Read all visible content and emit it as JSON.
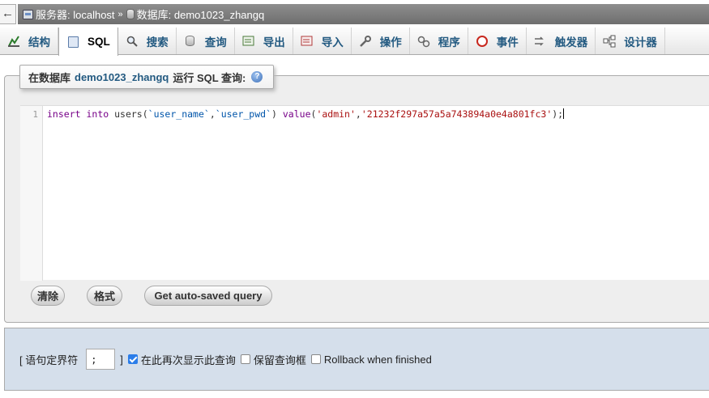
{
  "breadcrumb": {
    "back": "←",
    "server_label": "服务器: localhost",
    "separator": "»",
    "db_label": "数据库: demo1023_zhangq"
  },
  "tabs": [
    {
      "label": "结构",
      "icon": "structure-icon"
    },
    {
      "label": "SQL",
      "icon": "sql-icon"
    },
    {
      "label": "搜索",
      "icon": "search-icon"
    },
    {
      "label": "查询",
      "icon": "query-icon"
    },
    {
      "label": "导出",
      "icon": "export-icon"
    },
    {
      "label": "导入",
      "icon": "import-icon"
    },
    {
      "label": "操作",
      "icon": "wrench-icon"
    },
    {
      "label": "程序",
      "icon": "routines-icon"
    },
    {
      "label": "事件",
      "icon": "clock-icon"
    },
    {
      "label": "触发器",
      "icon": "triggers-icon"
    },
    {
      "label": "设计器",
      "icon": "designer-icon"
    }
  ],
  "legend": {
    "prefix": "在数据库",
    "db_name": "demo1023_zhangq",
    "suffix": "运行 SQL 查询:",
    "help": "?"
  },
  "editor": {
    "line_number": "1",
    "tokens": {
      "t1": "insert",
      "t2": " ",
      "t3": "into",
      "t4": " users(",
      "t5": "`user_name`",
      "t6": ",",
      "t7": "`user_pwd`",
      "t8": ") ",
      "t9": "value",
      "t10": "(",
      "t11": "'admin'",
      "t12": ",",
      "t13": "'21232f297a57a5a743894a0e4a801fc3'",
      "t14": ");"
    }
  },
  "buttons": {
    "clear": "清除",
    "format": "格式",
    "autosave": "Get auto-saved query"
  },
  "options": {
    "delimiter_label": "[ 语句定界符",
    "delimiter_value": ";",
    "bracket_close": "]",
    "show_again_label": "在此再次显示此查询",
    "retain_label": "保留查询框",
    "rollback_label": "Rollback when finished",
    "show_again_checked": true,
    "retain_checked": false,
    "rollback_checked": false
  }
}
